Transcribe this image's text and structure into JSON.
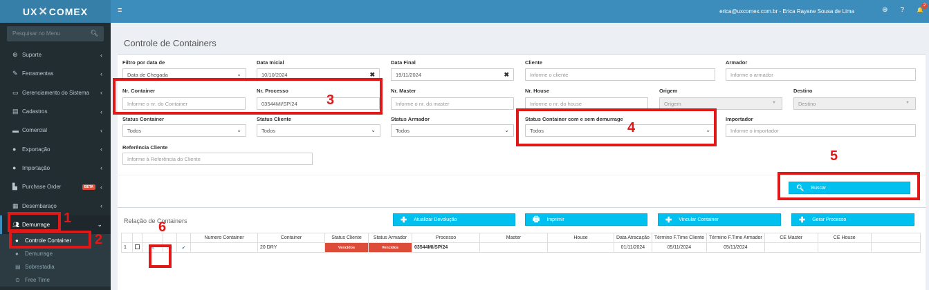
{
  "brand": {
    "logo_left": "UX",
    "logo_mark": "✕",
    "logo_right": "COMEX"
  },
  "topbar": {
    "user": "erica@uxcomex.com.br - Erica Rayane Sousa de Lima",
    "notif_count": "2",
    "add_icon": "⊕",
    "help": "?",
    "bell": "🔔",
    "menu_icon": "≡"
  },
  "sidebar": {
    "search_placeholder": "Pesquisar no Menu",
    "items": [
      {
        "label": "Suporte",
        "icon": "⊕"
      },
      {
        "label": "Ferramentas",
        "icon": "🔧"
      },
      {
        "label": "Gerenciamento do Sistema",
        "icon": "▭"
      },
      {
        "label": "Cadastros",
        "icon": "▤"
      },
      {
        "label": "Comercial",
        "icon": "▬"
      },
      {
        "label": "Exportação",
        "icon": "●"
      },
      {
        "label": "Importação",
        "icon": "●"
      },
      {
        "label": "Purchase Order",
        "icon": "▙",
        "badge": "BETA"
      },
      {
        "label": "Desembaraço",
        "icon": "▦"
      },
      {
        "label": "Demurrage",
        "icon": "👥"
      }
    ],
    "subitems": [
      {
        "label": "Controle Container",
        "icon": "👤"
      },
      {
        "label": "Demurrage",
        "icon": "👤"
      },
      {
        "label": "Sobrestadia",
        "icon": "▤"
      },
      {
        "label": "Free Time",
        "icon": "⊙"
      }
    ]
  },
  "page": {
    "title": "Controle de Containers"
  },
  "filters": {
    "filtro_label": "Filtro por data de",
    "filtro_value": "Data de Chegada",
    "data_inicial_label": "Data Inicial",
    "data_inicial_value": "10/10/2024",
    "data_final_label": "Data Final",
    "data_final_value": "19/11/2024",
    "cliente_label": "Cliente",
    "cliente_ph": "Informe o cliente",
    "armador_label": "Armador",
    "armador_ph": "Informe o armador",
    "nr_container_label": "Nr. Container",
    "nr_container_ph": "Informe o nr. do Container",
    "nr_processo_label": "Nr. Processo",
    "nr_processo_value": "03544MI/SP/24",
    "nr_master_label": "Nr. Master",
    "nr_master_ph": "Informe o nr. do master",
    "nr_house_label": "Nr. House",
    "nr_house_ph": "Informe o nr. do house",
    "origem_label": "Origem",
    "origem_ph": "Origem",
    "destino_label": "Destino",
    "destino_ph": "Destino",
    "status_container_label": "Status Container",
    "status_container_value": "Todos",
    "status_cliente_label": "Status Cliente",
    "status_cliente_value": "Todos",
    "status_armador_label": "Status Armador",
    "status_armador_value": "Todos",
    "status_demurrage_label": "Status Container com e sem demurrage",
    "status_demurrage_value": "Todos",
    "importador_label": "Importador",
    "importador_ph": "Informe o importador",
    "referencia_label": "Referência Cliente",
    "referencia_ph": "Informe à Referência do Cliente",
    "clear_icon": "✖",
    "dropdown_icon": "⌄"
  },
  "buttons": {
    "buscar": "Buscar",
    "buscar_icon": "🔍",
    "atualizar": "Atualizar Devolução",
    "imprimir": "Imprimir",
    "vincular": "Vincular Container",
    "gerar": "Gerar Processo",
    "plus": "✚",
    "print_icon": "🖶"
  },
  "list": {
    "title": "Relação de Containers"
  },
  "table": {
    "headers": [
      "Numero Container",
      "Container",
      "Status Cliente",
      "Status Armador",
      "Processo",
      "Master",
      "House",
      "Data Atracação",
      "Término F.Time Cliente",
      "Término F.Time Armador",
      "CE Master",
      "CE House"
    ],
    "rows": [
      {
        "idx": "1",
        "numero": "",
        "container": "20 DRY",
        "status_cliente": "Vencidos",
        "status_armador": "Vencidos",
        "processo": "03544MI/SP/24",
        "master": "",
        "house": "",
        "data_atracacao": "01/11/2024",
        "termino_cliente": "05/11/2024",
        "termino_armador": "05/11/2024",
        "ce_master": "",
        "ce_house": "",
        "edit_icon": "✎",
        "copy_icon": "❐",
        "check_icon": "✔"
      }
    ]
  },
  "annotations": [
    "1",
    "2",
    "3",
    "4",
    "5",
    "6"
  ],
  "colors": {
    "topbar": "#3c8dbc",
    "sidebar": "#222d32",
    "button": "#00c0ef",
    "danger": "#dd4b39",
    "annotation": "#e01818"
  }
}
